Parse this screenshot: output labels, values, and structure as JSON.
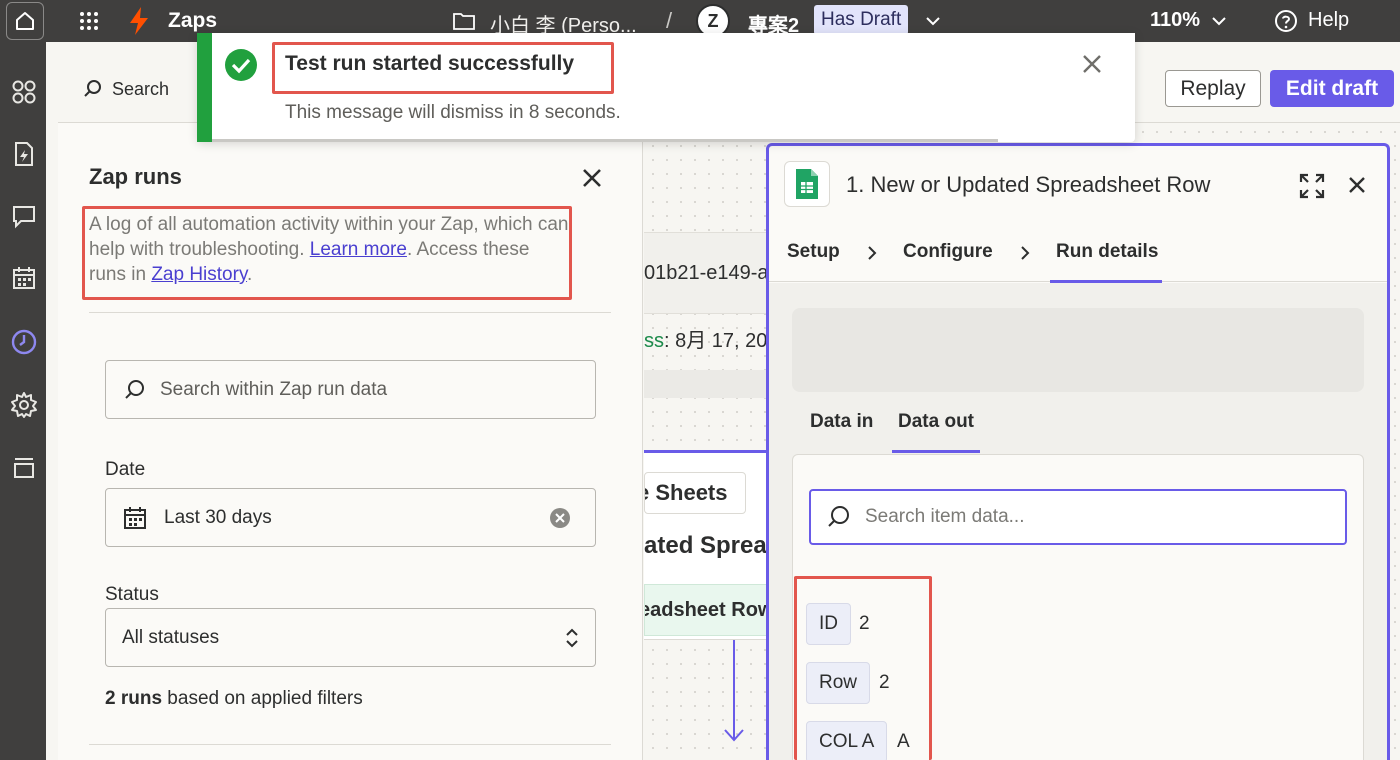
{
  "topbar": {
    "app_title": "Zaps",
    "folder": "小白 李 (Perso...",
    "separator": "/",
    "logo_letter": "Z",
    "project": "專案2",
    "draft_badge": "Has Draft",
    "zoom": "110%",
    "help": "Help"
  },
  "rail": {
    "icons": [
      "home-icon",
      "apps-icon",
      "zap-file-icon",
      "chat-icon",
      "calendar-icon",
      "history-icon",
      "settings-icon",
      "layers-icon"
    ]
  },
  "toolbar": {
    "search_label": "Search",
    "replay_label": "Replay",
    "edit_label": "Edit draft"
  },
  "toast": {
    "title": "Test run started successfully",
    "message": "This message will dismiss in 8 seconds.",
    "accent_color": "#21a03e"
  },
  "canvas": {
    "run_id_fragment": "01b21-e149-a",
    "status_fragment": "ss",
    "date_fragment": ":  8月 17, 20",
    "app_chip": "e Sheets",
    "step_title": "ated Sprea",
    "step_event": "eadsheet Row"
  },
  "runs": {
    "title": "Zap runs",
    "desc_1": "A log of all automation activity within your Zap, which can help with troubleshooting. ",
    "learn_more": "Learn more",
    "desc_2": ". Access these runs in ",
    "zap_history": "Zap History",
    "desc_3": ".",
    "search_placeholder": "Search within Zap run data",
    "date_label": "Date",
    "date_value": "Last 30 days",
    "status_label": "Status",
    "status_value": "All statuses",
    "count_bold": "2 runs",
    "count_rest": " based on applied filters"
  },
  "detail": {
    "title": "1. New or Updated Spreadsheet Row",
    "crumbs": [
      "Setup",
      "Configure",
      "Run details"
    ],
    "tabs": [
      "Data in",
      "Data out"
    ],
    "search_placeholder": "Search item data...",
    "fields": [
      {
        "key": "ID",
        "value": "2"
      },
      {
        "key": "Row",
        "value": "2"
      },
      {
        "key": "COL A",
        "value": "A"
      }
    ],
    "accent_color": "#695be8"
  }
}
